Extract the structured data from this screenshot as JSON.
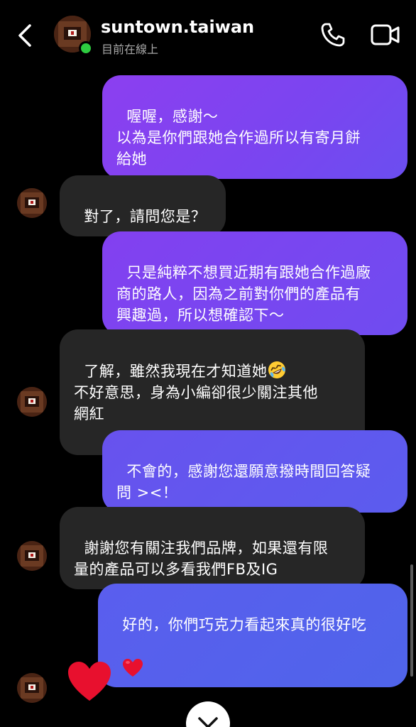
{
  "header": {
    "username": "suntown.taiwan",
    "status": "目前在線上",
    "icons": {
      "back": "chevron-left-icon",
      "call": "phone-icon",
      "video": "video-camera-icon"
    }
  },
  "messages": [
    {
      "sender": "me",
      "text": "喔喔，感謝～\n以為是你們跟她合作過所以有寄月餅\n給她"
    },
    {
      "sender": "them",
      "text": "對了，請問您是？"
    },
    {
      "sender": "me",
      "text": "只是純粹不想買近期有跟她合作過廠\n商的路人，因為之前對你們的產品有\n興趣過，所以想確認下～"
    },
    {
      "sender": "them",
      "text_line1": "了解，雖然我現在才知道她",
      "text_rest": "不好意思，身為小編卻很少關注其他\n網紅",
      "emoji": "rolling-on-floor-laughing"
    },
    {
      "sender": "me",
      "text": "不會的，感謝您還願意撥時間回答疑\n問 ><！"
    },
    {
      "sender": "them",
      "text": "謝謝您有關注我們品牌，如果還有限\n量的產品可以多看我們FB及IG"
    },
    {
      "sender": "me",
      "text": "好的，你們巧克力看起來真的很好吃",
      "emoji": "red-heart"
    },
    {
      "sender": "them",
      "reaction": "red-heart"
    }
  ],
  "colors": {
    "online": "#2ecc40",
    "incoming_bubble": "#262626",
    "outgoing_gradient_top": "#8c3ff0",
    "outgoing_gradient_bottom": "#4f64ea",
    "heart": "#e8102e"
  }
}
